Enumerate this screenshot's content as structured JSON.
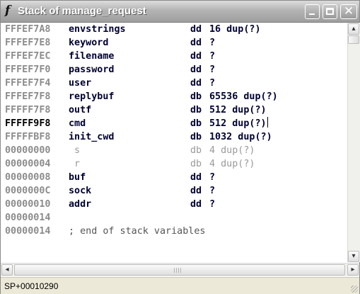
{
  "window": {
    "title": "Stack of manage_request",
    "icon": "function-icon"
  },
  "listing": {
    "rows": [
      {
        "addr": "FFFEF7A8",
        "name": "envstrings",
        "type": "dd",
        "operand": "16 dup(?)",
        "style": "normal"
      },
      {
        "addr": "FFFEF7E8",
        "name": "keyword",
        "type": "dd",
        "operand": "?",
        "style": "normal"
      },
      {
        "addr": "FFFEF7EC",
        "name": "filename",
        "type": "dd",
        "operand": "?",
        "style": "normal"
      },
      {
        "addr": "FFFEF7F0",
        "name": "password",
        "type": "dd",
        "operand": "?",
        "style": "normal"
      },
      {
        "addr": "FFFEF7F4",
        "name": "user",
        "type": "dd",
        "operand": "?",
        "style": "normal"
      },
      {
        "addr": "FFFEF7F8",
        "name": "replybuf",
        "type": "db",
        "operand": "65536 dup(?)",
        "style": "normal"
      },
      {
        "addr": "FFFFF7F8",
        "name": "outf",
        "type": "db",
        "operand": "512 dup(?)",
        "style": "normal"
      },
      {
        "addr": "FFFFF9F8",
        "name": "cmd",
        "type": "db",
        "operand": "512 dup(?)",
        "style": "current"
      },
      {
        "addr": "FFFFFBF8",
        "name": "init_cwd",
        "type": "db",
        "operand": "1032 dup(?)",
        "style": "normal"
      },
      {
        "addr": "00000000",
        "name": "s",
        "type": "db",
        "operand": "4 dup(?)",
        "style": "dim"
      },
      {
        "addr": "00000004",
        "name": "r",
        "type": "db",
        "operand": "4 dup(?)",
        "style": "dim"
      },
      {
        "addr": "00000008",
        "name": "buf",
        "type": "dd",
        "operand": "?",
        "style": "normal"
      },
      {
        "addr": "0000000C",
        "name": "sock",
        "type": "dd",
        "operand": "?",
        "style": "normal"
      },
      {
        "addr": "00000010",
        "name": "addr",
        "type": "dd",
        "operand": "?",
        "style": "normal"
      },
      {
        "addr": "00000014",
        "name": "",
        "type": "",
        "operand": "",
        "style": "normal"
      }
    ],
    "footer": {
      "addr": "00000014",
      "comment": "; end of stack variables"
    }
  },
  "status": {
    "text": "SP+00010290"
  }
}
